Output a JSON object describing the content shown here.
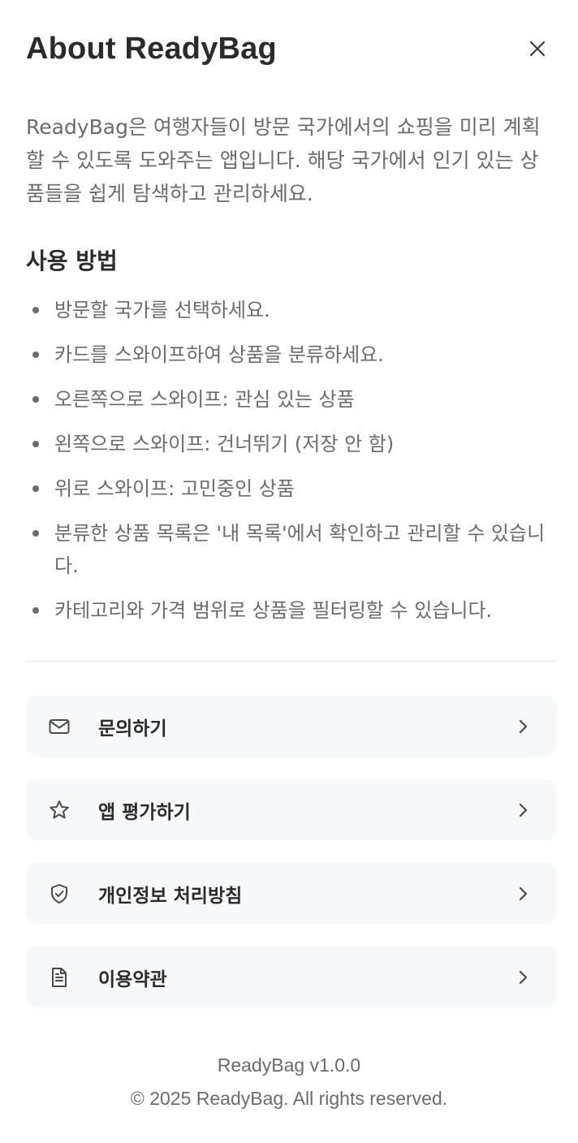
{
  "header": {
    "title": "About ReadyBag",
    "close_icon": "close-icon"
  },
  "intro": "ReadyBag은 여행자들이 방문 국가에서의 쇼핑을 미리 계획할 수 있도록 도와주는 앱입니다. 해당 국가에서 인기 있는 상품들을 쉽게 탐색하고 관리하세요.",
  "howto": {
    "title": "사용 방법",
    "items": [
      "방문할 국가를 선택하세요.",
      "카드를 스와이프하여 상품을 분류하세요.",
      "오른쪽으로 스와이프: 관심 있는 상품",
      "왼쪽으로 스와이프: 건너뛰기 (저장 안 함)",
      "위로 스와이프: 고민중인 상품",
      "분류한 상품 목록은 '내 목록'에서 확인하고 관리할 수 있습니다.",
      "카테고리와 가격 범위로 상품을 필터링할 수 있습니다."
    ]
  },
  "menu": [
    {
      "label": "문의하기",
      "icon": "mail-icon"
    },
    {
      "label": "앱 평가하기",
      "icon": "star-icon"
    },
    {
      "label": "개인정보 처리방침",
      "icon": "shield-check-icon"
    },
    {
      "label": "이용약관",
      "icon": "document-icon"
    }
  ],
  "footer": {
    "version": "ReadyBag v1.0.0",
    "copyright": "© 2025 ReadyBag. All rights reserved."
  },
  "colors": {
    "title": "#2b2b2b",
    "body_text": "#6b6b6b",
    "menu_bg": "#f7f8f9",
    "divider": "#e8e8e8"
  }
}
